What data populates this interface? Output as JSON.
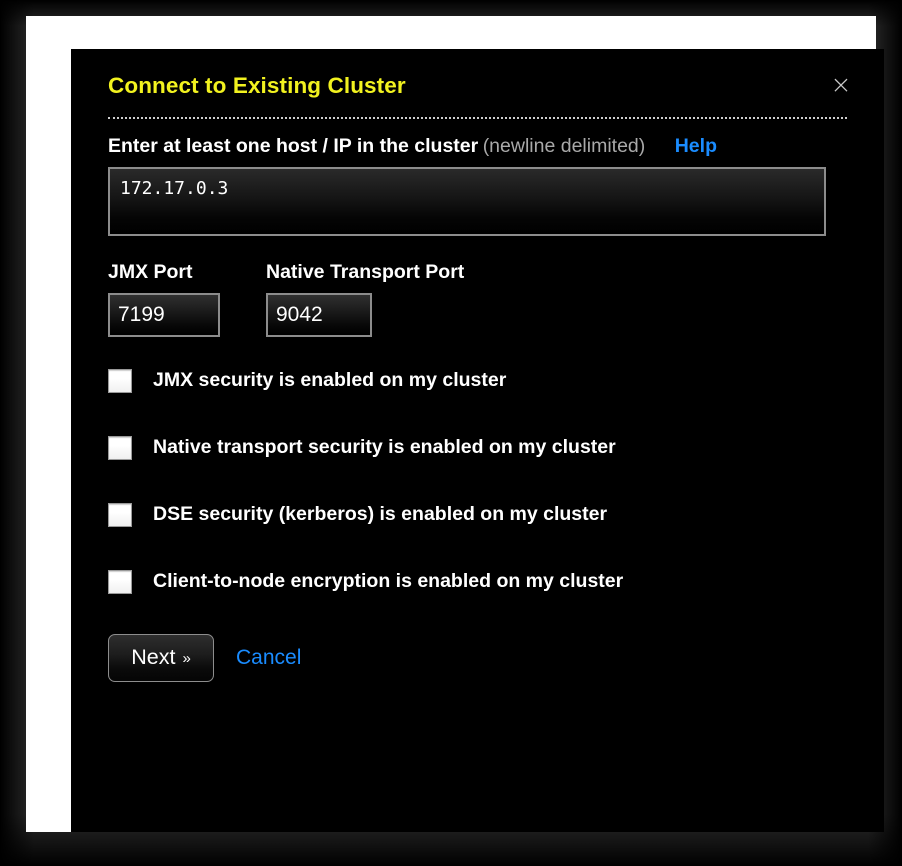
{
  "dialog": {
    "title": "Connect to Existing Cluster",
    "close_icon": "×",
    "host_field": {
      "label_strong": "Enter at least one host / IP in the cluster",
      "label_muted": "(newline delimited)",
      "help_label": "Help",
      "value": "172.17.0.3",
      "placeholder": ""
    },
    "ports": {
      "jmx_label": "JMX Port",
      "jmx_value": "7199",
      "native_label": "Native Transport Port",
      "native_value": "9042"
    },
    "checkboxes": [
      {
        "label": "JMX security is enabled on my cluster",
        "checked": false
      },
      {
        "label": "Native transport security is enabled on my cluster",
        "checked": false
      },
      {
        "label": "DSE security (kerberos) is enabled on my cluster",
        "checked": false
      },
      {
        "label": "Client-to-node encryption is enabled on my cluster",
        "checked": false
      }
    ],
    "footer": {
      "next_label": "Next",
      "next_chevron": "»",
      "cancel_label": "Cancel"
    }
  },
  "colors": {
    "title": "#f2f21f",
    "link": "#1a8cff",
    "label": "#ffffff",
    "muted": "#a9a9a9",
    "dialog_bg": "#000000",
    "frame": "#ffffff",
    "field_border": "#8c8c8c"
  }
}
